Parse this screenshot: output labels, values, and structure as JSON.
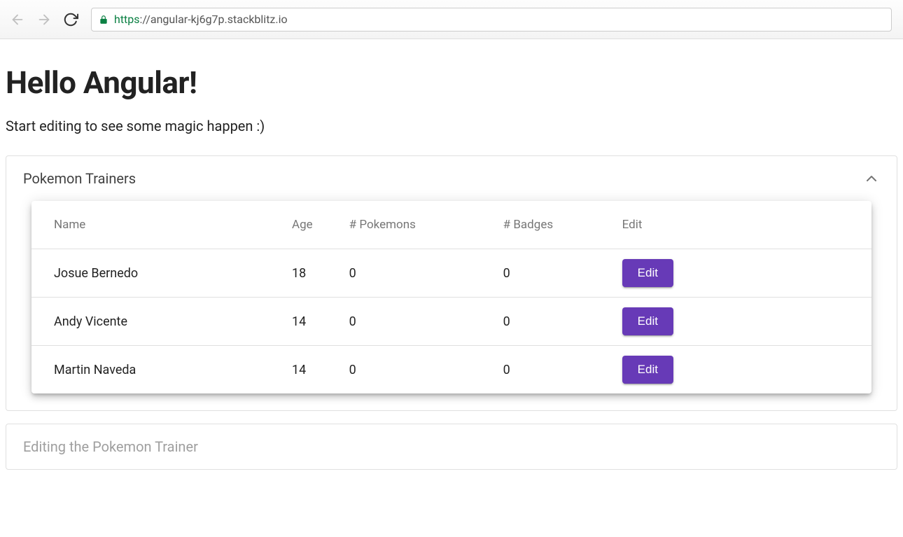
{
  "browser": {
    "url_scheme": "https",
    "url_rest": "://angular-kj6g7p.stackblitz.io"
  },
  "page": {
    "title": "Hello Angular!",
    "subtitle": "Start editing to see some magic happen :)"
  },
  "panel_trainers": {
    "title": "Pokemon Trainers"
  },
  "panel_editing": {
    "title": "Editing the Pokemon Trainer"
  },
  "table": {
    "headers": {
      "name": "Name",
      "age": "Age",
      "pokemons": "# Pokemons",
      "badges": "# Badges",
      "edit": "Edit"
    },
    "rows": [
      {
        "name": "Josue Bernedo",
        "age": "18",
        "pokemons": "0",
        "badges": "0"
      },
      {
        "name": "Andy Vicente",
        "age": "14",
        "pokemons": "0",
        "badges": "0"
      },
      {
        "name": "Martin Naveda",
        "age": "14",
        "pokemons": "0",
        "badges": "0"
      }
    ],
    "edit_label": "Edit"
  }
}
